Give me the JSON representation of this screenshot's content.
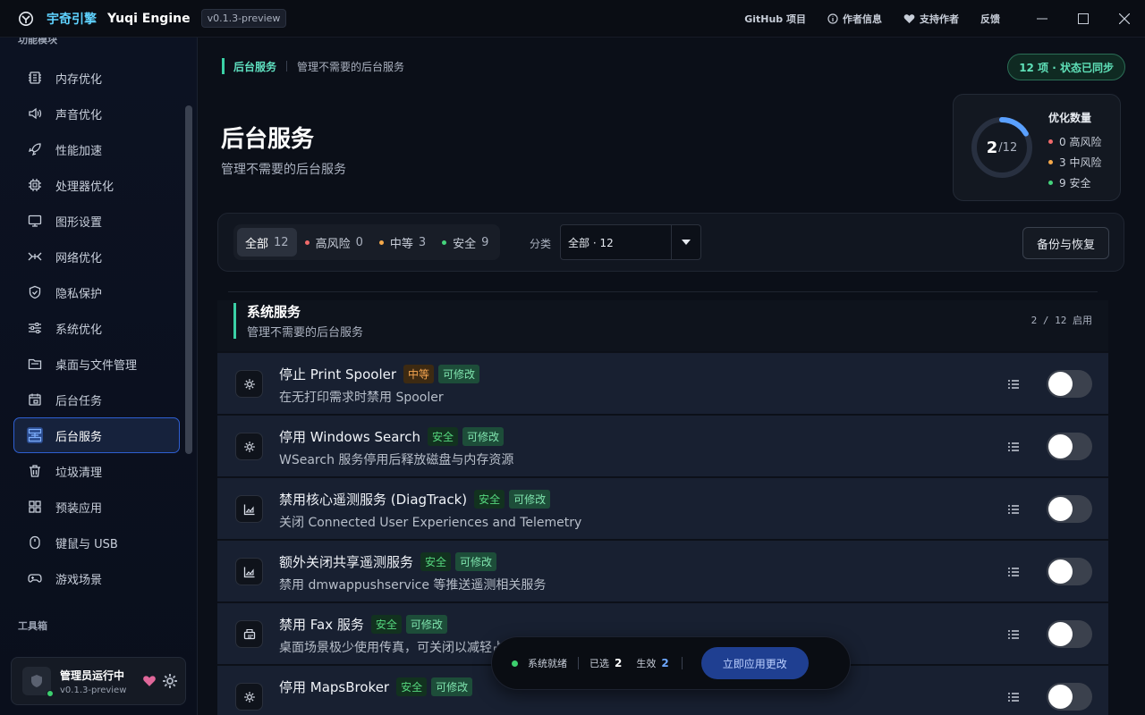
{
  "titlebar": {
    "app_name_cn": "宇奇引擎",
    "app_name_en": "Yuqi Engine",
    "version": "v0.1.3-preview",
    "links": [
      "GitHub 项目",
      "作者信息",
      "支持作者",
      "反馈"
    ]
  },
  "sidebar": {
    "section_top": "功能模块",
    "items": [
      {
        "label": "内存优化",
        "icon": "memory-chip-icon"
      },
      {
        "label": "声音优化",
        "icon": "speaker-icon"
      },
      {
        "label": "性能加速",
        "icon": "rocket-icon"
      },
      {
        "label": "处理器优化",
        "icon": "cpu-icon"
      },
      {
        "label": "图形设置",
        "icon": "monitor-icon"
      },
      {
        "label": "网络优化",
        "icon": "network-icon"
      },
      {
        "label": "隐私保护",
        "icon": "shield-icon"
      },
      {
        "label": "系统优化",
        "icon": "sliders-icon"
      },
      {
        "label": "桌面与文件管理",
        "icon": "folder-icon"
      },
      {
        "label": "后台任务",
        "icon": "calendar-icon"
      },
      {
        "label": "后台服务",
        "icon": "services-icon",
        "active": true
      },
      {
        "label": "垃圾清理",
        "icon": "trash-icon"
      },
      {
        "label": "预装应用",
        "icon": "apps-grid-icon"
      },
      {
        "label": "键鼠与 USB",
        "icon": "mouse-icon"
      },
      {
        "label": "游戏场景",
        "icon": "gamepad-icon"
      }
    ],
    "section_tools": "工具箱",
    "user": {
      "name": "管理员运行中",
      "version": "v0.1.3-preview"
    }
  },
  "main": {
    "breadcrumb": {
      "current": "后台服务",
      "desc": "管理不需要的后台服务"
    },
    "sync_badge": "12 项 · 状态已同步",
    "title": "后台服务",
    "subtitle": "管理不需要的后台服务",
    "stats": {
      "title": "优化数量",
      "enabled": "2",
      "total": "/12",
      "progress": 0.1667,
      "high": "0 高风险",
      "mid": "3 中风险",
      "safe": "9 安全"
    },
    "filters": {
      "all": "全部",
      "all_count": "12",
      "high": "高风险",
      "high_count": "0",
      "mid": "中等",
      "mid_count": "3",
      "safe": "安全",
      "safe_count": "9",
      "category_label": "分类",
      "category_value": "全部 · 12",
      "backup": "备份与恢复"
    },
    "section": {
      "title": "系统服务",
      "subtitle": "管理不需要的后台服务",
      "count": "2 / 12 启用"
    },
    "rows": [
      {
        "title": "停止 Print Spooler",
        "risk": "中等",
        "risk_class": "mid",
        "editable": "可修改",
        "desc": "在无打印需求时禁用 Spooler",
        "icon": "gear-icon"
      },
      {
        "title": "停用 Windows Search",
        "risk": "安全",
        "risk_class": "safe",
        "editable": "可修改",
        "desc": "WSearch 服务停用后释放磁盘与内存资源",
        "icon": "gear-icon"
      },
      {
        "title": "禁用核心遥测服务 (DiagTrack)",
        "risk": "安全",
        "risk_class": "safe",
        "editable": "可修改",
        "desc": "关闭 Connected User Experiences and Telemetry",
        "icon": "chart-icon"
      },
      {
        "title": "额外关闭共享遥测服务",
        "risk": "安全",
        "risk_class": "safe",
        "editable": "可修改",
        "desc": "禁用 dmwappushservice 等推送遥测相关服务",
        "icon": "chart-icon"
      },
      {
        "title": "禁用 Fax 服务",
        "risk": "安全",
        "risk_class": "safe",
        "editable": "可修改",
        "desc": "桌面场景极少使用传真，可关闭以减轻占用",
        "icon": "fax-icon"
      },
      {
        "title": "停用 MapsBroker",
        "risk": "安全",
        "risk_class": "safe",
        "editable": "可修改",
        "desc": "",
        "icon": "gear-icon"
      }
    ]
  },
  "footer": {
    "status": "系统就绪",
    "selected_label": "已选",
    "selected": "2",
    "effective_label": "生效",
    "effective": "2",
    "apply": "立即应用更改"
  }
}
